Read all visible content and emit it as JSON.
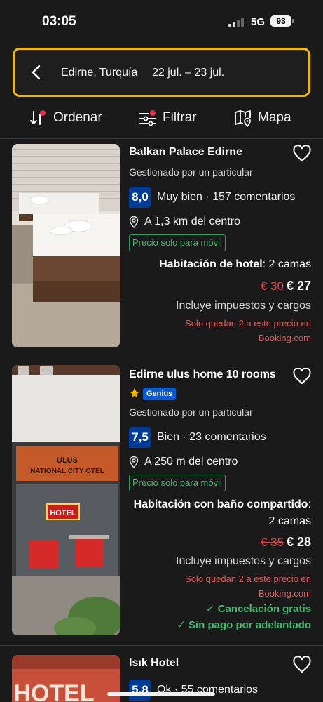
{
  "status_bar": {
    "time": "03:05",
    "network": "5G",
    "battery": "93"
  },
  "search": {
    "location": "Edirne, Turquía",
    "dates": "22 jul. – 23 jul."
  },
  "toolbar": {
    "sort_label": "Ordenar",
    "filter_label": "Filtrar",
    "map_label": "Mapa"
  },
  "hotels": [
    {
      "name": "Balkan Palace Edirne",
      "managed": "Gestionado por un particular",
      "score": "8,0",
      "review_text": "Muy bien · 157 comentarios",
      "distance": "A 1,3 km del centro",
      "mobile_badge": "Precio solo para móvil",
      "room_type": "Habitación de hotel",
      "room_beds": ": 2 camas",
      "old_price": "€ 30",
      "new_price": "€ 27",
      "taxes": "Incluye impuestos y cargos",
      "scarcity": "Solo quedan 2 a este precio en Booking.com"
    },
    {
      "name": "Edirne ulus home 10 rooms",
      "genius": "Genius",
      "managed": "Gestionado por un particular",
      "score": "7,5",
      "review_text": "Bien · 23 comentarios",
      "distance": "A 250 m del centro",
      "mobile_badge": "Precio solo para móvil",
      "room_type": "Habitación con baño compartido",
      "room_beds_colon": ":",
      "room_beds": "2 camas",
      "old_price": "€ 35",
      "new_price": "€ 28",
      "taxes": "Incluye impuestos y cargos",
      "scarcity": "Solo quedan 2 a este precio en Booking.com",
      "perks": [
        "✓ Cancelación gratis",
        "✓ Sin pago por adelantado"
      ],
      "photo_sign_1": "ULUS",
      "photo_sign_2": "NATIONAL CITY OTEL",
      "photo_hotel_sign": "HOTEL"
    },
    {
      "name": "Isık Hotel",
      "score": "5,8",
      "review_text": "Ok · 55 comentarios",
      "photo_sign": "HOTEL"
    }
  ],
  "colors": {
    "accent_yellow": "#f0b800",
    "score_blue": "#003b95",
    "green": "#45b86f",
    "red": "#e04444"
  }
}
